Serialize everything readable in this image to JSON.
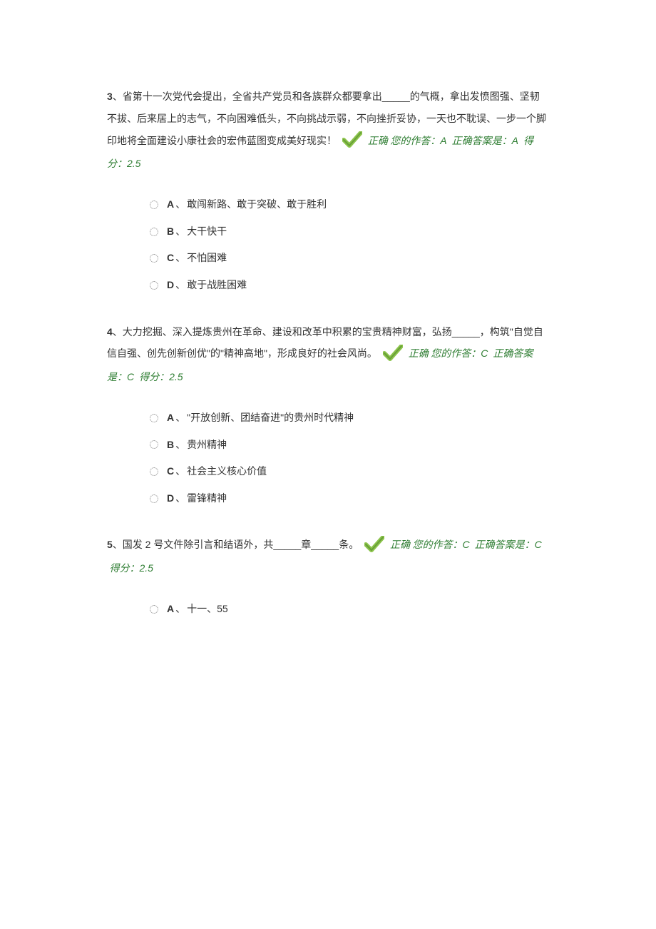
{
  "questions": [
    {
      "num": "3",
      "stem_before": "、省第十一次党代会提出，全省共产党员和各族群众都要拿出_____的气概，拿出发愤图强、坚韧不拔、后来居上的志气，不向困难低头，不向挑战示弱，不向挫折妥协，一天也不耽误、一步一个脚印地将全面建设小康社会的宏伟蓝图变成美好现实！",
      "stem_after": "",
      "feedback": {
        "status": "正确",
        "prefix_your": "您的作答：",
        "your": "A",
        "prefix_correct": "正确答案是：",
        "correct": "A",
        "prefix_score": "得分：",
        "score": "2.5"
      },
      "options": [
        {
          "letter": "A",
          "text": "敢闯新路、敢于突破、敢于胜利"
        },
        {
          "letter": "B",
          "text": "大干快干"
        },
        {
          "letter": "C",
          "text": "不怕困难"
        },
        {
          "letter": "D",
          "text": "敢于战胜困难"
        }
      ]
    },
    {
      "num": "4",
      "stem_before": "、大力挖掘、深入提炼贵州在革命、建设和改革中积累的宝贵精神财富，弘扬_____，构筑\"自觉自信自强、创先创新创优\"的\"精神高地\"，形成良好的社会风尚。",
      "stem_after": "",
      "feedback": {
        "status": "正确",
        "prefix_your": "您的作答：",
        "your": "C",
        "prefix_correct": "正确答案是：",
        "correct": "C",
        "prefix_score": "得分：",
        "score": "2.5"
      },
      "options": [
        {
          "letter": "A",
          "text": "\"开放创新、团结奋进\"的贵州时代精神"
        },
        {
          "letter": "B",
          "text": "贵州精神"
        },
        {
          "letter": "C",
          "text": "社会主义核心价值"
        },
        {
          "letter": "D",
          "text": "雷锋精神"
        }
      ]
    },
    {
      "num": "5",
      "stem_before": "、国发 2 号文件除引言和结语外，共_____章_____条。",
      "stem_after": "",
      "feedback": {
        "status": "正确",
        "prefix_your": "您的作答：",
        "your": "C",
        "prefix_correct": "正确答案是：",
        "correct": "C",
        "prefix_score": "得分：",
        "score": "2.5"
      },
      "options": [
        {
          "letter": "A",
          "text": "十一、55"
        }
      ]
    }
  ]
}
